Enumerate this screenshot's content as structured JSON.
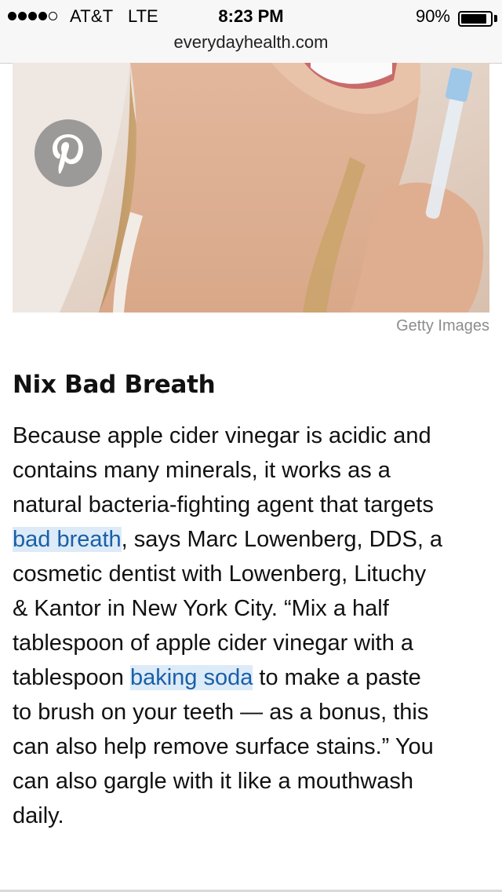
{
  "status_bar": {
    "carrier": "AT&T",
    "network": "LTE",
    "time": "8:23 PM",
    "battery_percent_label": "90%",
    "battery_level": 0.9,
    "signal_bars_filled": 4,
    "signal_bars_total": 5
  },
  "browser": {
    "url": "everydayhealth.com"
  },
  "hero": {
    "pin_icon": "pinterest-icon",
    "caption": "Getty Images"
  },
  "article": {
    "heading": "Nix Bad Breath",
    "lines": [
      {
        "segments": [
          {
            "text": "Because apple cider vinegar is acidic and"
          }
        ]
      },
      {
        "segments": [
          {
            "text": "contains many minerals, it works as a"
          }
        ]
      },
      {
        "segments": [
          {
            "text": "natural bacteria-fighting agent that targets"
          }
        ]
      },
      {
        "segments": [
          {
            "text": "bad breath",
            "link": true
          },
          {
            "text": ", says Marc Lowenberg, DDS, a"
          }
        ]
      },
      {
        "segments": [
          {
            "text": "cosmetic dentist with Lowenberg, Lituchy"
          }
        ]
      },
      {
        "segments": [
          {
            "text": "& Kantor in New York City. “Mix a half"
          }
        ]
      },
      {
        "segments": [
          {
            "text": "tablespoon of apple cider vinegar with a"
          }
        ]
      },
      {
        "segments": [
          {
            "text": "tablespoon "
          },
          {
            "text": "baking soda",
            "link": true
          },
          {
            "text": " to make a paste"
          }
        ]
      },
      {
        "segments": [
          {
            "text": "to brush on your teeth — as a bonus, this"
          }
        ]
      },
      {
        "segments": [
          {
            "text": "can also help remove surface stains.” You"
          }
        ]
      },
      {
        "segments": [
          {
            "text": "can also gargle with it like a mouthwash"
          }
        ]
      },
      {
        "segments": [
          {
            "text": "daily."
          }
        ]
      }
    ]
  },
  "colors": {
    "link": "#1a5fa8",
    "link_highlight": "#dcebf7",
    "caption": "#8c8c8c"
  }
}
